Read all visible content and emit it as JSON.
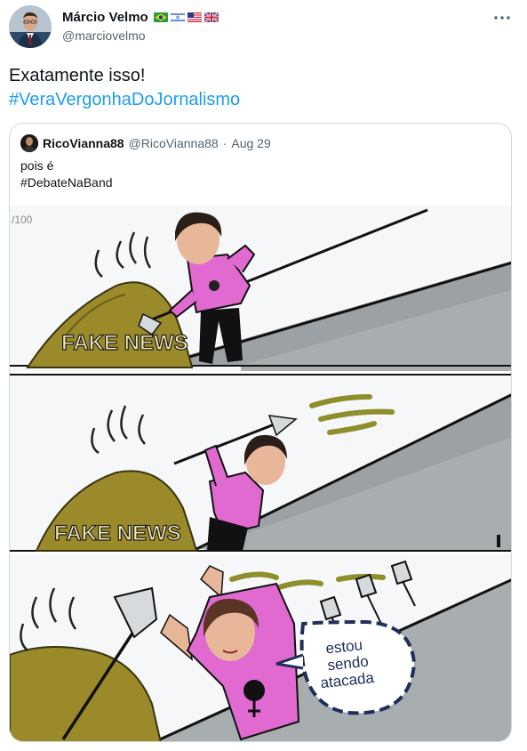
{
  "author": {
    "name": "Márcio Velmo",
    "handle": "@marciovelmo",
    "flags": [
      "brazil-flag",
      "israel-flag",
      "usa-flag",
      "uk-flag"
    ]
  },
  "tweet": {
    "text": "Exatamente isso!",
    "hashtag": "#VeraVergonhaDoJornalismo"
  },
  "quoted": {
    "name": "RicoVianna88",
    "handle": "@RicoVianna88",
    "separator": "·",
    "date": "Aug 29",
    "line1": "pois é",
    "line2": "#DebateNaBand",
    "comic": {
      "corner_text": "/100",
      "panel1_label": "FAKE NEWS",
      "panel2_label": "FAKE NEWS",
      "bubble_line1": "estou",
      "bubble_line2": "sendo",
      "bubble_line3": "atacada"
    }
  },
  "colors": {
    "hashtag": "#1d9bf0",
    "secondary_text": "#536471",
    "border": "#cfd9de",
    "shirt": "#e06ad0",
    "pile": "#9a8a2a"
  }
}
